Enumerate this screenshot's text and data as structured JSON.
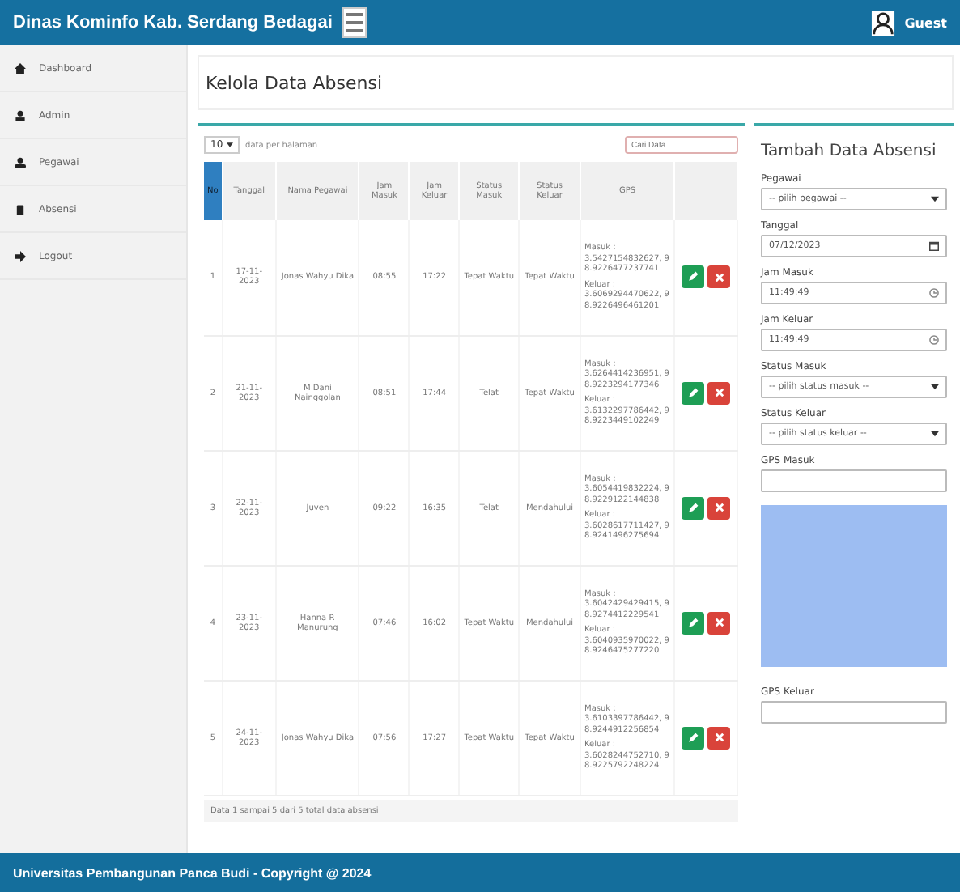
{
  "header": {
    "title": "Dinas Kominfo Kab. Serdang Bedagai",
    "user": "Guest"
  },
  "sidebar": {
    "items": [
      {
        "label": "Dashboard",
        "kind": "home",
        "selected": false
      },
      {
        "label": "Admin",
        "kind": "user",
        "selected": false
      },
      {
        "label": "Pegawai",
        "kind": "users",
        "selected": false
      },
      {
        "label": "Absensi",
        "kind": "clip",
        "selected": false
      },
      {
        "label": "Logout",
        "kind": "logout",
        "selected": false
      }
    ]
  },
  "page_title": "Kelola Data Absensi",
  "table": {
    "page_size": "10",
    "page_size_label": "data per halaman",
    "search": {
      "placeholder": "Cari Data"
    },
    "columns": [
      "No",
      "Tanggal",
      "Nama Pegawai",
      "Jam Masuk",
      "Jam Keluar",
      "Status Masuk",
      "Status Keluar",
      "GPS"
    ],
    "rows": [
      {
        "no": "1",
        "tanggal": "17-11-2023",
        "nama": "Jonas Wahyu Dika",
        "jam_masuk": "08:55",
        "jam_keluar": "17:22",
        "status_masuk": "Tepat Waktu",
        "status_keluar": "Tepat Waktu",
        "gps": [
          {
            "label": "Masuk :",
            "value": "3.5427154832627, 98.9226477237741"
          },
          {
            "label": "Keluar :",
            "value": "3.6069294470622, 98.9226496461201"
          }
        ]
      },
      {
        "no": "2",
        "tanggal": "21-11-2023",
        "nama": "M Dani Nainggolan",
        "jam_masuk": "08:51",
        "jam_keluar": "17:44",
        "status_masuk": "Telat",
        "status_keluar": "Tepat Waktu",
        "gps": [
          {
            "label": "Masuk :",
            "value": "3.6264414236951, 98.9223294177346"
          },
          {
            "label": "Keluar :",
            "value": "3.6132297786442, 98.9223449102249"
          }
        ]
      },
      {
        "no": "3",
        "tanggal": "22-11-2023",
        "nama": "Juven",
        "jam_masuk": "09:22",
        "jam_keluar": "16:35",
        "status_masuk": "Telat",
        "status_keluar": "Mendahului",
        "gps": [
          {
            "label": "Masuk :",
            "value": "3.6054419832224, 98.9229122144838"
          },
          {
            "label": "Keluar :",
            "value": "3.6028617711427, 98.9241496275694"
          }
        ]
      },
      {
        "no": "4",
        "tanggal": "23-11-2023",
        "nama": "Hanna P. Manurung",
        "jam_masuk": "07:46",
        "jam_keluar": "16:02",
        "status_masuk": "Tepat Waktu",
        "status_keluar": "Mendahului",
        "gps": [
          {
            "label": "Masuk :",
            "value": "3.6042429429415, 98.9274412229541"
          },
          {
            "label": "Keluar :",
            "value": "3.6040935970022, 98.9246475277220"
          }
        ]
      },
      {
        "no": "5",
        "tanggal": "24-11-2023",
        "nama": "Jonas Wahyu Dika",
        "jam_masuk": "07:56",
        "jam_keluar": "17:27",
        "status_masuk": "Tepat Waktu",
        "status_keluar": "Tepat Waktu",
        "gps": [
          {
            "label": "Masuk :",
            "value": "3.6103397786442, 98.9244912256854"
          },
          {
            "label": "Keluar :",
            "value": "3.6028244752710, 98.9225792248224"
          }
        ]
      }
    ],
    "footer": "Data 1 sampai 5 dari 5 total data absensi"
  },
  "form": {
    "title": "Tambah Data Absensi",
    "fields": [
      {
        "kind": "select",
        "label": "Pegawai",
        "value": "-- pilih pegawai --"
      },
      {
        "kind": "date",
        "label": "Tanggal",
        "value": "07/12/2023"
      },
      {
        "kind": "time",
        "label": "Jam Masuk",
        "value": "11:49:49"
      },
      {
        "kind": "time",
        "label": "Jam Keluar",
        "value": "11:49:49"
      },
      {
        "kind": "select",
        "label": "Status Masuk",
        "value": "-- pilih status masuk --"
      },
      {
        "kind": "select",
        "label": "Status Keluar",
        "value": "-- pilih status keluar --"
      },
      {
        "kind": "text",
        "label": "GPS Masuk"
      },
      {
        "kind": "map"
      },
      {
        "kind": "text",
        "label": "GPS Keluar"
      }
    ]
  },
  "footer": "Universitas Pembangunan Panca Budi - Copyright @ 2024"
}
